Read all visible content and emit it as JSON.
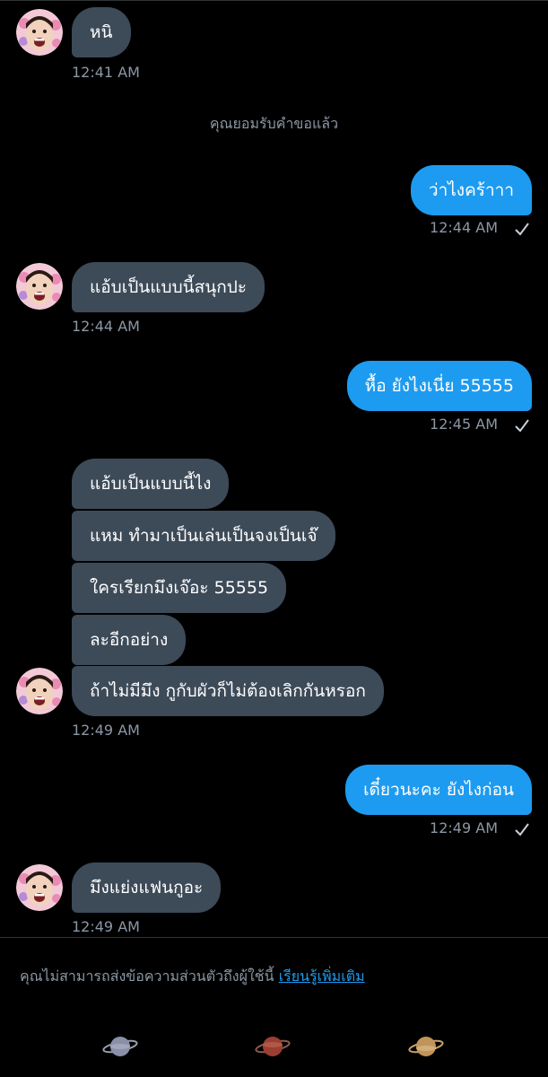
{
  "messages": {
    "m1": {
      "text": "หนิ",
      "time": "12:41 AM"
    },
    "system_notice": "คุณยอมรับคำขอแล้ว",
    "m2": {
      "text": "ว่าไงคร้าาา",
      "time": "12:44 AM"
    },
    "m3": {
      "text": "แอ้บเป็นแบบนี้สนุกปะ",
      "time": "12:44 AM"
    },
    "m4": {
      "text": "หื้อ ยังไงเนี่ย 55555",
      "time": "12:45 AM"
    },
    "group": {
      "lines": [
        "แอ้บเป็นแบบนี้ไง",
        "แหม ทำมาเป็นเล่นเป็นจงเป็นเจ๊",
        "ใครเรียกมึงเจ๊อะ 55555",
        "ละอีกอย่าง",
        "ถ้าไม่มีมึง กูกับผัวก็ไม่ต้องเลิกกันหรอก"
      ],
      "time": "12:49 AM"
    },
    "m5": {
      "text": "เดี๋ยวนะคะ ยังไงก่อน",
      "time": "12:49 AM"
    },
    "m6": {
      "text": "มึงแย่งแฟนกูอะ",
      "time": "12:49 AM"
    }
  },
  "footer": {
    "notice_text": "คุณไม่สามารถส่งข้อความส่วนตัวถึงผู้ใช้นี้ ",
    "learn_more_link": "เรียนรู้เพิ่มเติม"
  },
  "nav": {
    "icons": [
      "planet-icon-gray",
      "planet-icon-red",
      "planet-icon-gold"
    ]
  },
  "colors": {
    "background": "#000000",
    "incoming_bubble": "#3d4a58",
    "outgoing_bubble": "#1d9bf0",
    "secondary_text": "#8b98a5",
    "link": "#1d9bf0"
  }
}
